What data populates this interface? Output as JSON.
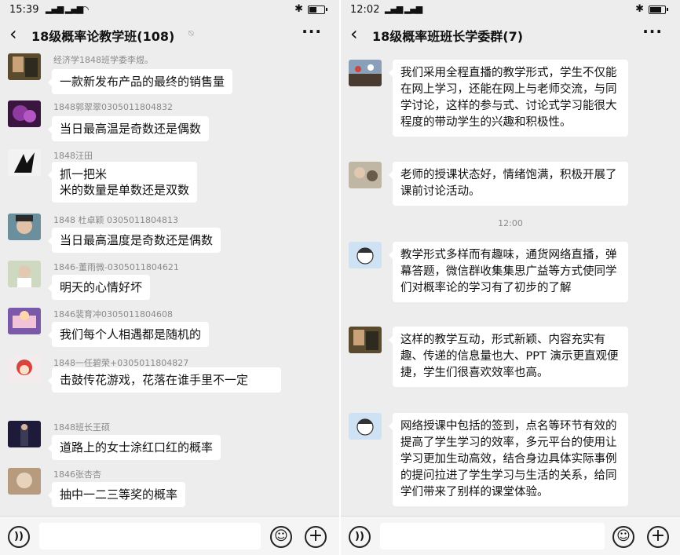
{
  "left": {
    "status": {
      "time": "15:39",
      "signal": "4G 4G"
    },
    "title": "18级概率论教学班(108)",
    "messages": [
      {
        "sender": "经济学1848班学委李煜。",
        "text": "一款新发布产品的最终的销售量"
      },
      {
        "sender": "1848郭翠翠0305011804832",
        "text": "当日最高温是奇数还是偶数"
      },
      {
        "sender": "1848汪田",
        "text": "抓一把米\n米的数量是单数还是双数"
      },
      {
        "sender": "1848 杜卓颖 0305011804813",
        "text": "当日最高温度是奇数还是偶数"
      },
      {
        "sender": "1846-董雨微-0305011804621",
        "text": "明天的心情好坏"
      },
      {
        "sender": "1846裴育冲0305011804608",
        "text": "我们每个人相遇都是随机的"
      },
      {
        "sender": "1848一任碧荣+0305011804827",
        "text": "击鼓传花游戏，花落在谁手里不一定"
      },
      {
        "sender": "1848班长王硕",
        "text": "道路上的女士涂红口红的概率"
      },
      {
        "sender": "1846张杏杏",
        "text": "抽中一二三等奖的概率"
      }
    ]
  },
  "right": {
    "status": {
      "time": "12:02",
      "signal": "4G 4G"
    },
    "title": "18级概率班班长学委群(7)",
    "timestamp": "12:00",
    "messages": [
      {
        "text": "我们采用全程直播的教学形式，学生不仅能在网上学习，还能在网上与老师交流，与同学讨论，这样的参与式、讨论式学习能很大程度的带动学生的兴趣和积极性。"
      },
      {
        "text": "老师的授课状态好，情绪饱满，积极开展了课前讨论活动。"
      },
      {
        "text": "教学形式多样而有趣味，通货网络直播，弹幕答题，微信群收集集思广益等方式使同学们对概率论的学习有了初步的了解"
      },
      {
        "text": "这样的教学互动，形式新颖、内容充实有趣、传递的信息量也大、PPT 演示更直观便捷，学生们很喜欢效率也高。"
      },
      {
        "text": "网络授课中包括的签到，点名等环节有效的提高了学生学习的效率，多元平台的使用让学习更加生动高效，结合身边具体实际事例的提问拉进了学生学习与生活的关系，给同学们带来了别样的课堂体验。"
      }
    ]
  },
  "icons": {
    "back": "‹",
    "more": "···",
    "voice": "))",
    "emoji": "☺",
    "plus": "+",
    "bluetooth": "✱",
    "mute": "⍉"
  },
  "colors": {
    "chat_bg": "#ededed",
    "bubble": "#ffffff",
    "meta": "#8a8a8a"
  }
}
